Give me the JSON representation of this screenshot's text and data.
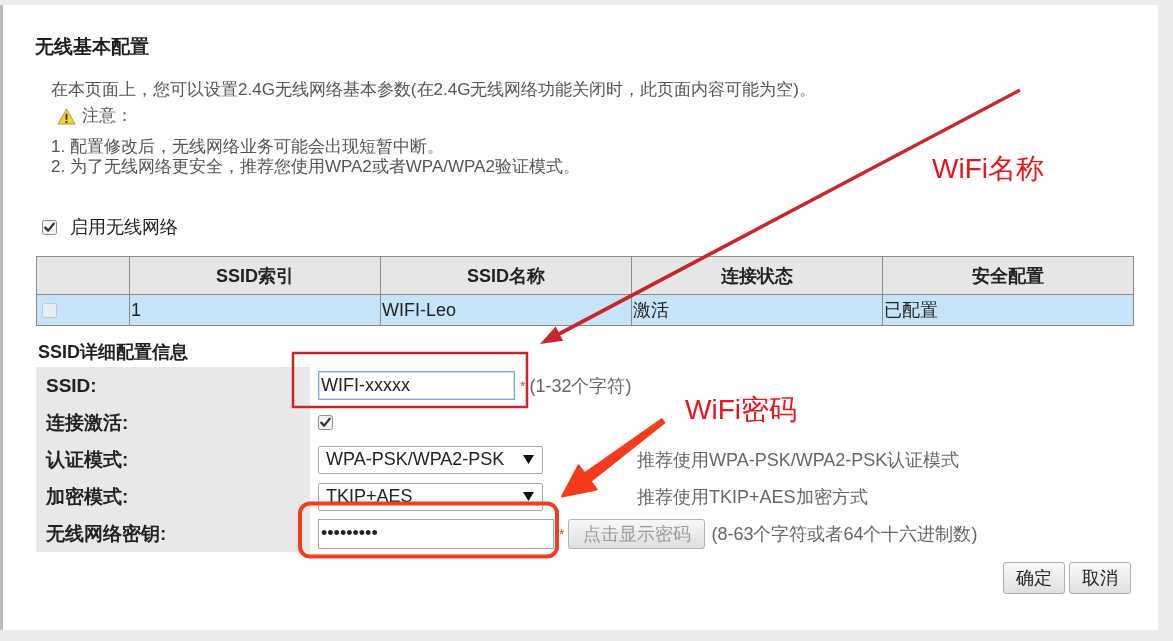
{
  "page": {
    "title": "无线基本配置",
    "intro": "在本页面上，您可以设置2.4G无线网络基本参数(在2.4G无线网络功能关闭时，此页面内容可能为空)。",
    "notice": {
      "heading": "注意：",
      "items": [
        "1. 配置修改后，无线网络业务可能会出现短暂中断。",
        "2. 为了无线网络更安全，推荐您使用WPA2或者WPA/WPA2验证模式。"
      ]
    }
  },
  "enable_wireless": {
    "label": "启用无线网络",
    "checked": true
  },
  "ssid_table": {
    "columns": [
      "SSID索引",
      "SSID名称",
      "连接状态",
      "安全配置"
    ],
    "rows": [
      {
        "selected": true,
        "checked": false,
        "disabled": true,
        "cells": [
          "1",
          "WIFI-Leo",
          "激活",
          "已配置"
        ]
      }
    ]
  },
  "details": {
    "heading": "SSID详细配置信息",
    "fields": [
      {
        "kind": "text",
        "label": "SSID:",
        "value": "WIFI-xxxxx",
        "focused": true,
        "mark": "*",
        "hint": "(1-32个字符)",
        "callout": {
          "kind": "thin",
          "text": "WiFi名称"
        }
      },
      {
        "kind": "checkbox",
        "label": "连接激活:",
        "checked": true
      },
      {
        "kind": "select",
        "label": "认证模式:",
        "value": "WPA-PSK/WPA2-PSK",
        "hint": "推荐使用WPA-PSK/WPA2-PSK认证模式"
      },
      {
        "kind": "select",
        "label": "加密模式:",
        "value": "TKIP+AES",
        "hint": "推荐使用TKIP+AES加密方式"
      },
      {
        "kind": "password",
        "label": "无线网络密钥:",
        "value": "•••••••••",
        "focused": false,
        "mark": "*",
        "button": {
          "label": "点击显示密码",
          "disabled": true
        },
        "hint": "(8-63个字符或者64个十六进制数)",
        "callout": {
          "kind": "bold",
          "text": "WiFi密码"
        }
      }
    ]
  },
  "buttons": [
    {
      "label": "确定"
    },
    {
      "label": "取消"
    }
  ]
}
